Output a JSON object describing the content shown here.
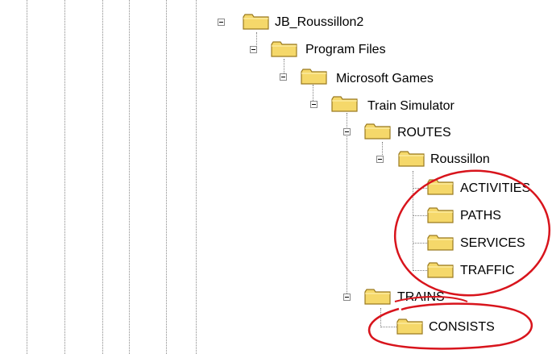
{
  "tree": {
    "nodes": [
      {
        "label": "JB_Roussillon2",
        "expanded": true
      },
      {
        "label": "Program Files",
        "expanded": true
      },
      {
        "label": "Microsoft Games",
        "expanded": true
      },
      {
        "label": "Train Simulator",
        "expanded": true
      },
      {
        "label": "ROUTES",
        "expanded": true
      },
      {
        "label": "Roussillon",
        "expanded": true
      },
      {
        "label": "ACTIVITIES"
      },
      {
        "label": "PATHS"
      },
      {
        "label": "SERVICES"
      },
      {
        "label": "TRAFFIC"
      },
      {
        "label": "TRAINS",
        "expanded": true
      },
      {
        "label": "CONSISTS"
      }
    ]
  },
  "colors": {
    "folder_fill": "#f5d86a",
    "folder_edge": "#9a7a20",
    "annotation_red": "#d8141c"
  },
  "icons": [
    "folder-icon",
    "collapse-icon"
  ]
}
